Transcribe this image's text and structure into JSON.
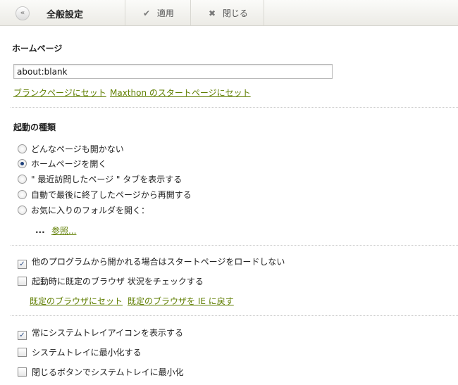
{
  "toolbar": {
    "back_icon": "«",
    "title": "全般設定",
    "apply_label": "適用",
    "apply_icon": "✔",
    "close_label": "閉じる",
    "close_icon": "✖"
  },
  "homepage": {
    "title": "ホームページ",
    "url_value": "about:blank",
    "link_blank": "ブランクページにセット",
    "link_maxthon": "Maxthon のスタートページにセット"
  },
  "startup": {
    "title": "起動の種類",
    "options": [
      {
        "label": "どんなページも開かない",
        "selected": false
      },
      {
        "label": "ホームページを開く",
        "selected": true
      },
      {
        "label": "\" 最近訪問したページ \" タブを表示する",
        "selected": false
      },
      {
        "label": "自動で最後に終了したページから再開する",
        "selected": false
      },
      {
        "label": "お気に入りのフォルダを開く：",
        "selected": false
      }
    ],
    "folder_dots": "...",
    "browse_link": "参照..."
  },
  "browser": {
    "check1": {
      "label": "他のプログラムから開かれる場合はスタートページをロードしない",
      "checked": true
    },
    "check2": {
      "label": "起動時に既定のブラウザ 状況をチェックする",
      "checked": false
    },
    "link_default": "既定のブラウザにセット",
    "link_ie": "既定のブラウザを IE に戻す"
  },
  "tray": {
    "check1": {
      "label": "常にシステムトレイアイコンを表示する",
      "checked": true
    },
    "check2": {
      "label": "システムトレイに最小化する",
      "checked": false
    },
    "check3": {
      "label": "閉じるボタンでシステムトレイに最小化",
      "checked": false
    }
  }
}
